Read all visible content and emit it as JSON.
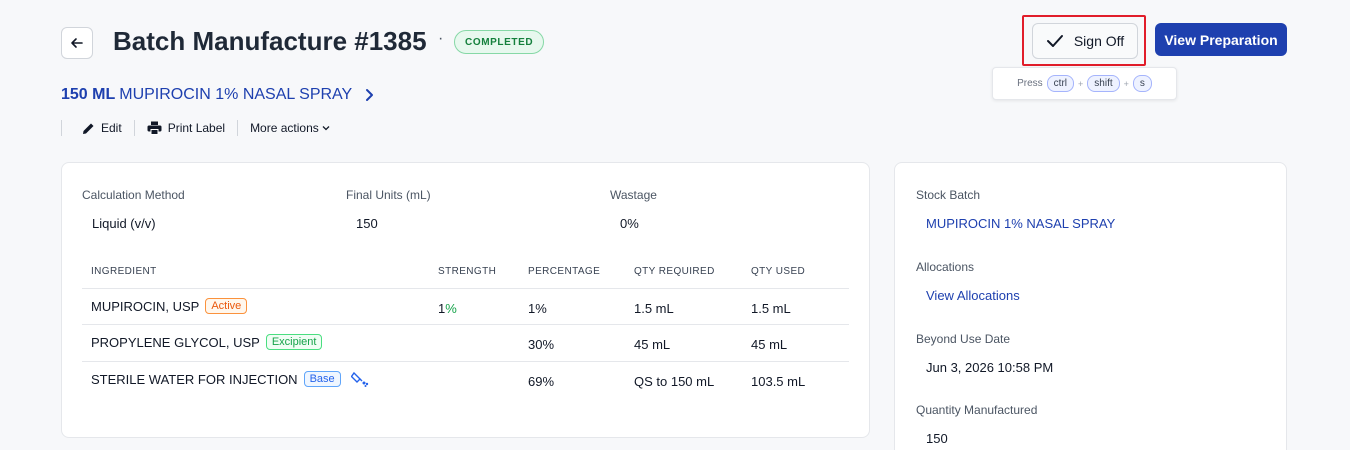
{
  "header": {
    "title": "Batch Manufacture #1385",
    "dot": "·",
    "status": "COMPLETED",
    "sign_off_label": "Sign Off",
    "view_preparation_label": "View Preparation",
    "shortcut": {
      "press": "Press",
      "keys": [
        "ctrl",
        "shift",
        "s"
      ],
      "plus": "+"
    }
  },
  "product": {
    "size": "150 ML",
    "name": "MUPIROCIN 1% NASAL SPRAY"
  },
  "actions": {
    "edit": "Edit",
    "print_label": "Print Label",
    "more_actions": "More actions"
  },
  "calc": {
    "method_label": "Calculation Method",
    "method_value": "Liquid (v/v)",
    "final_units_label": "Final Units (mL)",
    "final_units_value": "150",
    "wastage_label": "Wastage",
    "wastage_value": "0%"
  },
  "table": {
    "headers": [
      "INGREDIENT",
      "STRENGTH",
      "PERCENTAGE",
      "QTY REQUIRED",
      "QTY USED"
    ],
    "rows": [
      {
        "name": "MUPIROCIN, USP",
        "tag": "Active",
        "strength": "1",
        "strength_unit": "%",
        "percentage": "1%",
        "qty_required": "1.5 mL",
        "qty_used": "1.5 mL"
      },
      {
        "name": "PROPYLENE GLYCOL, USP",
        "tag": "Excipient",
        "strength": "",
        "strength_unit": "",
        "percentage": "30%",
        "qty_required": "45 mL",
        "qty_used": "45 mL"
      },
      {
        "name": "STERILE WATER FOR INJECTION",
        "tag": "Base",
        "strength": "",
        "strength_unit": "",
        "percentage": "69%",
        "qty_required": "QS to 150 mL",
        "qty_used": "103.5 mL"
      }
    ]
  },
  "side": {
    "stock_batch_label": "Stock Batch",
    "stock_batch_value": "MUPIROCIN 1% NASAL SPRAY",
    "allocations_label": "Allocations",
    "allocations_link": "View Allocations",
    "bud_label": "Beyond Use Date",
    "bud_value": "Jun 3, 2026 10:58 PM",
    "qty_label": "Quantity Manufactured",
    "qty_value": "150"
  },
  "colors": {
    "primary": "#1e40af",
    "status_green": "#15803d",
    "highlight_red": "#e11d2a"
  }
}
